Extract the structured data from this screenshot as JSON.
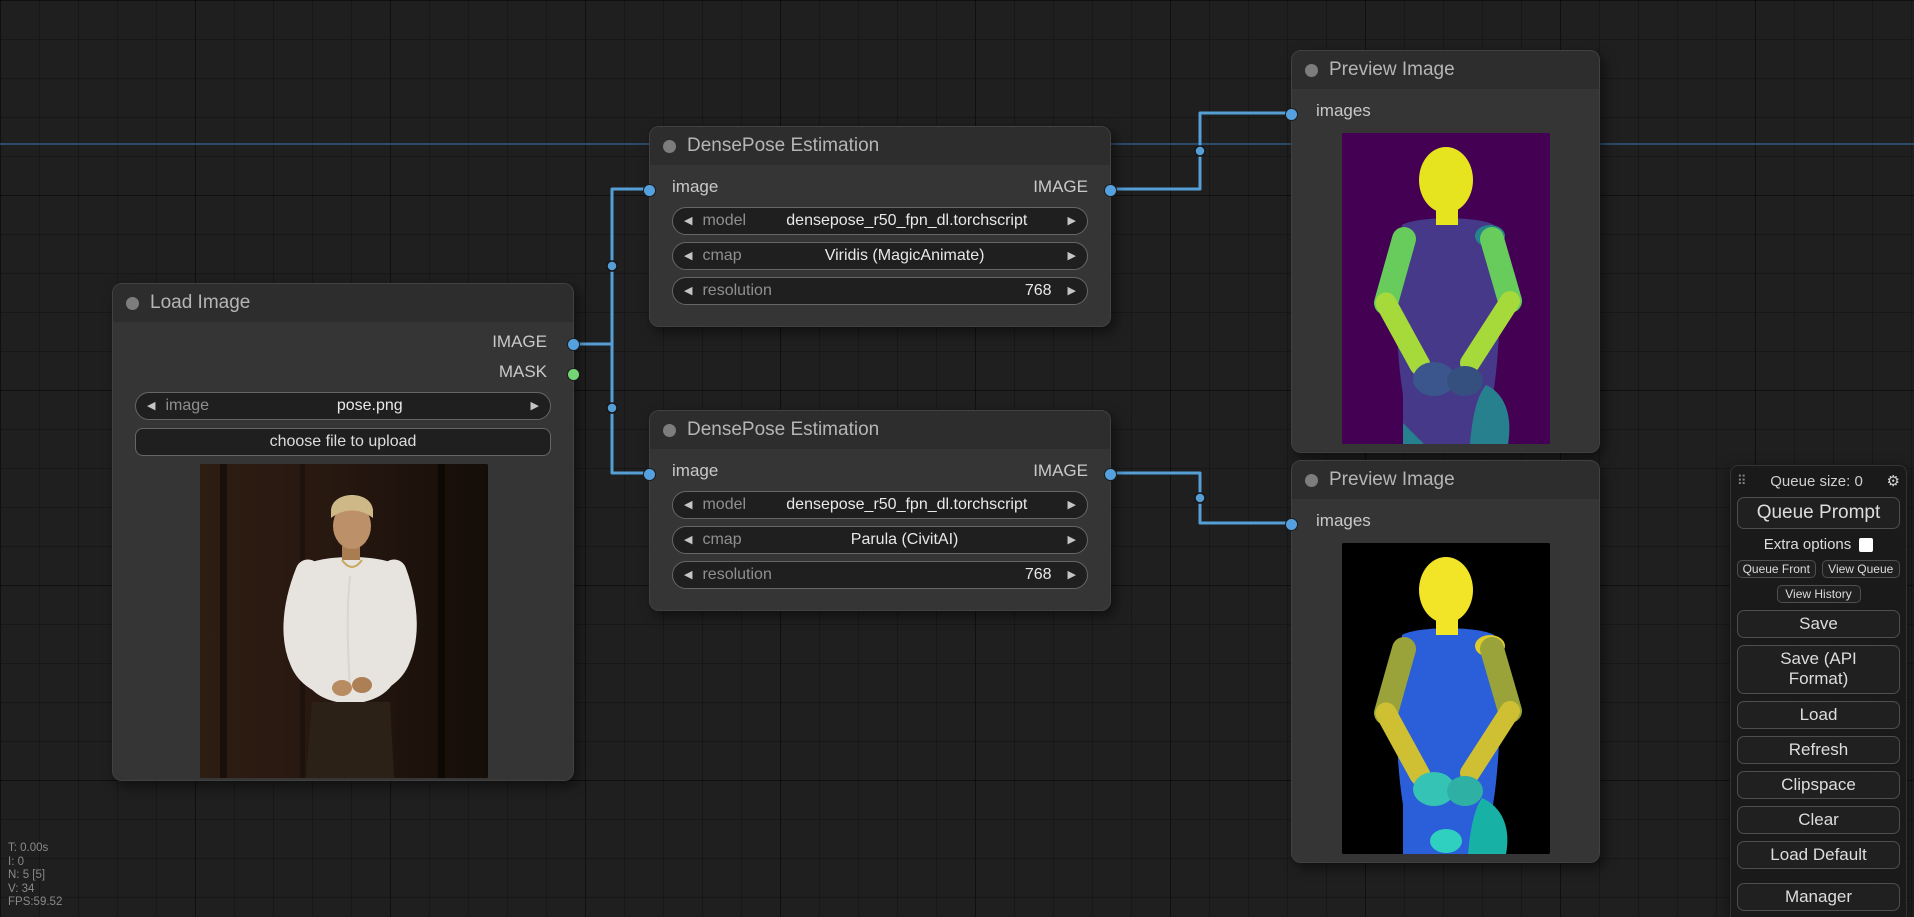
{
  "icons": {
    "arrow_left": "◀",
    "arrow_right": "▶",
    "gear": "⚙",
    "drag_handle": "⠿"
  },
  "colors": {
    "canvas_bg": "#1f1f1f",
    "node_bg": "#353535",
    "node_title_bg": "#2d2d2d",
    "link_blue": "#569fd6",
    "slot_image": "#55a1df",
    "slot_mask": "#74d574",
    "viridis_bg": "#440154",
    "parula_bg": "#000000"
  },
  "nodes": {
    "load_image": {
      "title": "Load Image",
      "output_image": "IMAGE",
      "output_mask": "MASK",
      "image_widget": {
        "label": "image",
        "value": "pose.png"
      },
      "upload_label": "choose file to upload"
    },
    "densepose_top": {
      "title": "DensePose Estimation",
      "input_label": "image",
      "output_label": "IMAGE",
      "widgets": [
        {
          "label": "model",
          "value": "densepose_r50_fpn_dl.torchscript"
        },
        {
          "label": "cmap",
          "value": "Viridis (MagicAnimate)"
        },
        {
          "label": "resolution",
          "value": "768"
        }
      ]
    },
    "densepose_bottom": {
      "title": "DensePose Estimation",
      "input_label": "image",
      "output_label": "IMAGE",
      "widgets": [
        {
          "label": "model",
          "value": "densepose_r50_fpn_dl.torchscript"
        },
        {
          "label": "cmap",
          "value": "Parula (CivitAI)"
        },
        {
          "label": "resolution",
          "value": "768"
        }
      ]
    },
    "preview_top": {
      "title": "Preview Image",
      "input_label": "images"
    },
    "preview_bottom": {
      "title": "Preview Image",
      "input_label": "images"
    }
  },
  "menu": {
    "queue_size": "Queue size: 0",
    "extra_options": "Extra options",
    "buttons": {
      "queue_prompt": "Queue Prompt",
      "queue_front": "Queue Front",
      "view_queue": "View Queue",
      "view_history": "View History",
      "save": "Save",
      "save_api": "Save (API Format)",
      "load": "Load",
      "refresh": "Refresh",
      "clipspace": "Clipspace",
      "clear": "Clear",
      "load_default": "Load Default",
      "manager": "Manager"
    }
  },
  "stats": [
    "T: 0.00s",
    "I: 0",
    "N: 5 [5]",
    "V: 34",
    "FPS:59.52"
  ]
}
